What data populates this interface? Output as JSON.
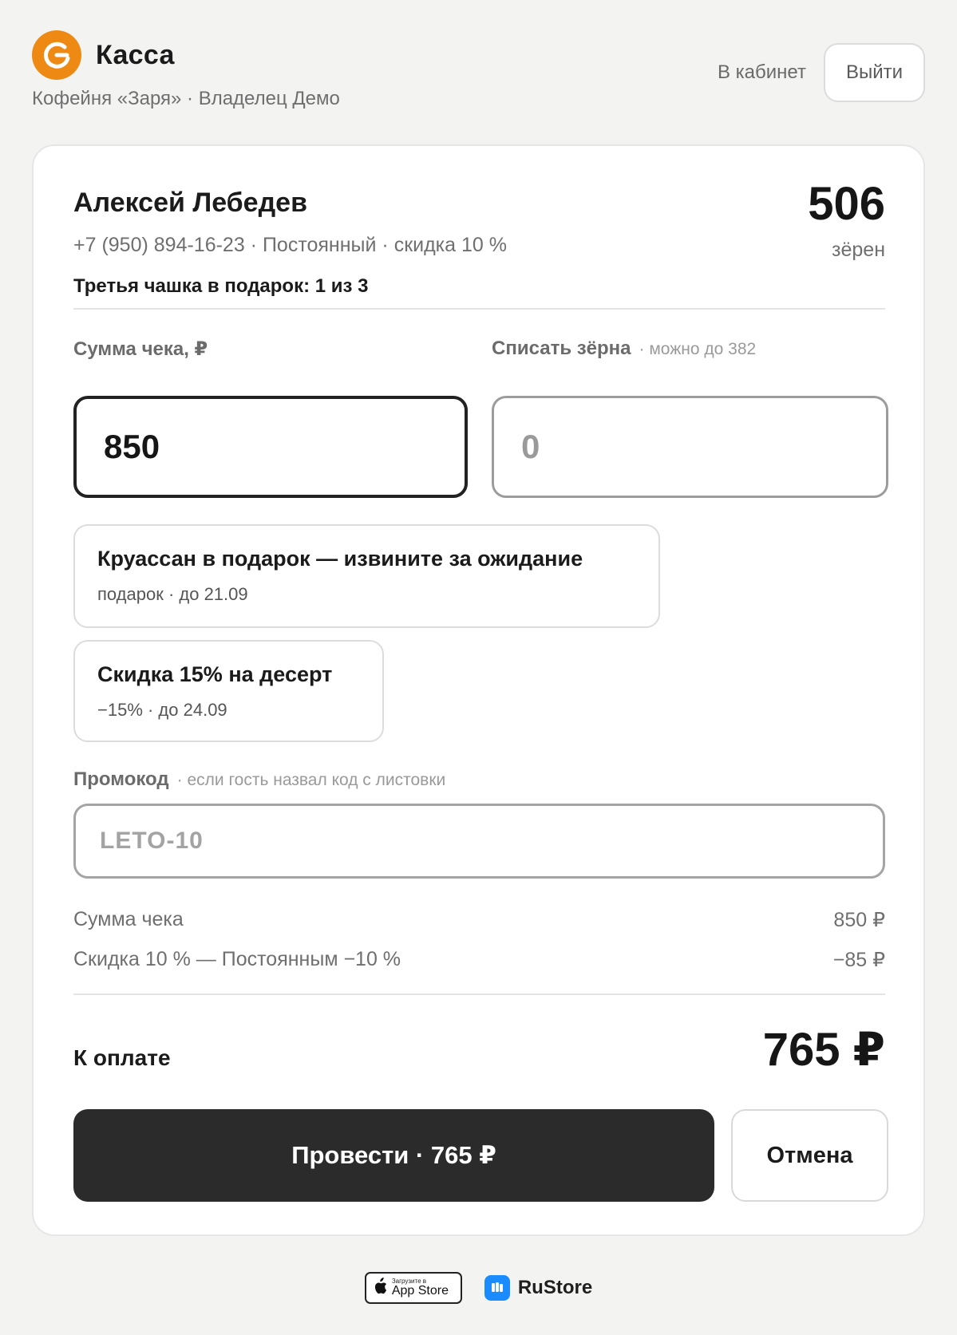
{
  "header": {
    "title": "Касса",
    "subtitle": "Кофейня «Заря» · Владелец Демо",
    "cabinet_link": "В кабинет",
    "logout_button": "Выйти",
    "accent_color": "#ee8a14"
  },
  "customer": {
    "name": "Алексей Лебедев",
    "meta": "+7 (950) 894-16-23 · Постоянный · скидка 10 %",
    "loyalty": "Третья чашка в подарок: 1 из 3",
    "beans_count": "506",
    "beans_label": "зёрен"
  },
  "form": {
    "sum_label": "Сумма чека, ₽",
    "sum_value": "850",
    "beans_label": "Списать зёрна",
    "beans_hint": "· можно до 382",
    "beans_placeholder": "0",
    "promo_label": "Промокод",
    "promo_hint": "· если гость назвал код с листовки",
    "promo_placeholder": "LETO-10"
  },
  "offers": [
    {
      "title": "Круассан в подарок — извините за ожидание",
      "meta": "подарок · до 21.09"
    },
    {
      "title": "Скидка 15% на десерт",
      "meta": "−15% · до 24.09"
    }
  ],
  "summary": {
    "rows": [
      {
        "label": "Сумма чека",
        "value": "850 ₽"
      },
      {
        "label": "Скидка 10 % — Постоянным −10 %",
        "value": "−85 ₽"
      }
    ],
    "total_label": "К оплате",
    "total_value": "765 ₽"
  },
  "actions": {
    "submit": "Провести · 765 ₽",
    "cancel": "Отмена"
  },
  "footer": {
    "appstore_small": "Загрузите в",
    "appstore_big": "App Store",
    "rustore": "RuStore"
  }
}
